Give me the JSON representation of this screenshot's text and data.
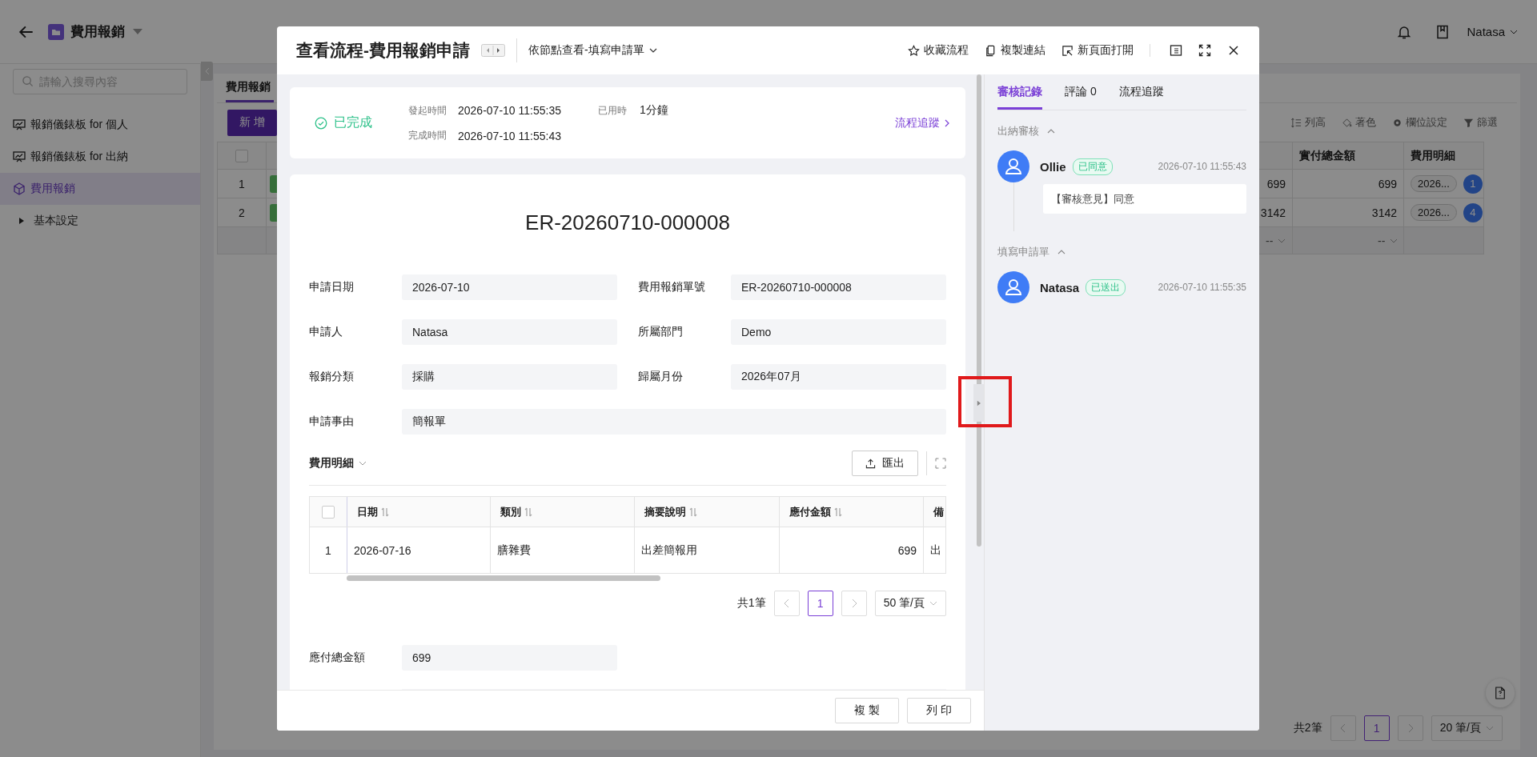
{
  "app_header": {
    "title": "費用報銷",
    "user": "Natasa"
  },
  "sidebar": {
    "search": {
      "placeholder": "請輸入搜尋內容"
    },
    "items": [
      {
        "label": "報銷儀錶板 for 個人",
        "kind": "dashboard",
        "selected": false
      },
      {
        "label": "報銷儀錶板 for 出納",
        "kind": "dashboard",
        "selected": false
      },
      {
        "label": "費用報銷",
        "kind": "form",
        "selected": true
      },
      {
        "label": "基本設定",
        "kind": "folder",
        "selected": false
      }
    ]
  },
  "main": {
    "tabs": [
      {
        "label": "費用報銷",
        "selected": true
      }
    ],
    "add_button": "新 增",
    "tools": [
      {
        "label": "列高",
        "kind": "row-height"
      },
      {
        "label": "著色",
        "kind": "paint"
      },
      {
        "label": "欄位設定",
        "kind": "gear"
      },
      {
        "label": "篩選",
        "kind": "filter"
      }
    ],
    "table": {
      "select_all": {
        "checked": false
      },
      "columns": [
        {
          "label": "實付總金額"
        },
        {
          "label": "費用明細"
        }
      ],
      "rows": [
        {
          "index": "1",
          "column_3": "699",
          "total": "699",
          "detail": "2026...",
          "detail_count": "1"
        },
        {
          "index": "2",
          "column_3": "3142",
          "total": "3142",
          "detail": "2026...",
          "detail_count": "4"
        }
      ],
      "summary": [
        "--",
        "--"
      ]
    },
    "pagination": {
      "total": "共2筆",
      "pages": [
        {
          "label": "1",
          "selected": true
        }
      ],
      "page_size": "20 筆/頁"
    }
  },
  "modal": {
    "title": "查看流程-費用報銷申請",
    "view_select": "依節點查看-填寫申請單",
    "actions": [
      {
        "label": "收藏流程",
        "kind": "star"
      },
      {
        "label": "複製連結",
        "kind": "copy"
      },
      {
        "label": "新頁面打開",
        "kind": "open"
      }
    ],
    "status": {
      "label": "已完成",
      "started_label": "發起時間",
      "started": "2026-07-10 11:55:35",
      "elapsed_label": "已用時",
      "elapsed": "1分鐘",
      "finished_label": "完成時間",
      "finished": "2026-07-10 11:55:43",
      "trace_link": "流程追蹤"
    },
    "form": {
      "title": "ER-20260710-000008",
      "fields": [
        {
          "label": "申請日期",
          "value": "2026-07-10",
          "kind": "half"
        },
        {
          "label": "費用報銷單號",
          "value": "ER-20260710-000008",
          "kind": "half"
        },
        {
          "label": "申請人",
          "value": "Natasa",
          "kind": "half"
        },
        {
          "label": "所屬部門",
          "value": "Demo",
          "kind": "half"
        },
        {
          "label": "報銷分類",
          "value": "採購",
          "kind": "half"
        },
        {
          "label": "歸屬月份",
          "value": "2026年07月",
          "kind": "half"
        },
        {
          "label": "申請事由",
          "value": "簡報單",
          "kind": "wide"
        }
      ]
    },
    "details": {
      "title": "費用明細",
      "export": "匯出",
      "select_all": {
        "checked": false
      },
      "columns": [
        {
          "label": "日期",
          "kind": "text"
        },
        {
          "label": "類別",
          "kind": "text"
        },
        {
          "label": "摘要說明",
          "kind": "text"
        },
        {
          "label": "應付金額",
          "kind": "amount"
        },
        {
          "label": "備",
          "kind": "text"
        }
      ],
      "rows": [
        {
          "index": "1",
          "cells": [
            "2026-07-16",
            "膳雜費",
            "出差簡報用",
            "699",
            "出"
          ]
        }
      ],
      "pagination": {
        "total": "共1筆",
        "pages": [
          {
            "label": "1",
            "selected": true
          }
        ],
        "page_size": "50 筆/頁"
      }
    },
    "total_field": {
      "label": "應付總金額",
      "value": "699"
    },
    "footer_buttons": [
      "複 製",
      "列 印"
    ],
    "side_panel": {
      "tabs": [
        {
          "label": "審核記錄",
          "selected": true
        },
        {
          "label": "評論 0",
          "selected": false
        },
        {
          "label": "流程追蹤",
          "selected": false
        }
      ],
      "groups": [
        {
          "title": "出納審核",
          "expanded": true,
          "entries": [
            {
              "name": "Ollie",
              "status": "已同意",
              "time": "2026-07-10 11:55:43",
              "comment": "【審核意見】同意"
            }
          ]
        },
        {
          "title": "填寫申請單",
          "expanded": true,
          "entries": [
            {
              "name": "Natasa",
              "status": "已送出",
              "time": "2026-07-10 11:55:35"
            }
          ]
        }
      ]
    }
  }
}
